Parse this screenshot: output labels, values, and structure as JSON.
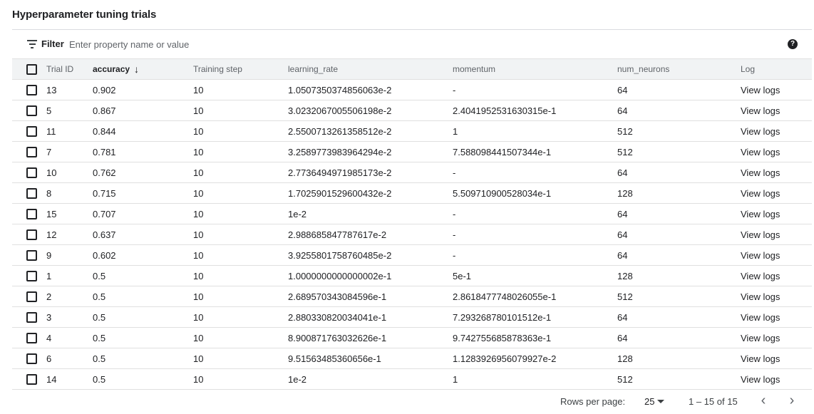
{
  "title": "Hyperparameter tuning trials",
  "filter": {
    "label": "Filter",
    "placeholder": "Enter property name or value",
    "help_icon": "?"
  },
  "columns": {
    "trial_id": "Trial ID",
    "accuracy": "accuracy",
    "sort_arrow": "↓",
    "training_step": "Training step",
    "learning_rate": "learning_rate",
    "momentum": "momentum",
    "num_neurons": "num_neurons",
    "log": "Log"
  },
  "rows": [
    {
      "trial_id": "13",
      "accuracy": "0.902",
      "training_step": "10",
      "learning_rate": "1.0507350374856063e-2",
      "momentum": "-",
      "num_neurons": "64",
      "log": "View logs"
    },
    {
      "trial_id": "5",
      "accuracy": "0.867",
      "training_step": "10",
      "learning_rate": "3.0232067005506198e-2",
      "momentum": "2.4041952531630315e-1",
      "num_neurons": "64",
      "log": "View logs"
    },
    {
      "trial_id": "11",
      "accuracy": "0.844",
      "training_step": "10",
      "learning_rate": "2.5500713261358512e-2",
      "momentum": "1",
      "num_neurons": "512",
      "log": "View logs"
    },
    {
      "trial_id": "7",
      "accuracy": "0.781",
      "training_step": "10",
      "learning_rate": "3.2589773983964294e-2",
      "momentum": "7.588098441507344e-1",
      "num_neurons": "512",
      "log": "View logs"
    },
    {
      "trial_id": "10",
      "accuracy": "0.762",
      "training_step": "10",
      "learning_rate": "2.7736494971985173e-2",
      "momentum": "-",
      "num_neurons": "64",
      "log": "View logs"
    },
    {
      "trial_id": "8",
      "accuracy": "0.715",
      "training_step": "10",
      "learning_rate": "1.7025901529600432e-2",
      "momentum": "5.509710900528034e-1",
      "num_neurons": "128",
      "log": "View logs"
    },
    {
      "trial_id": "15",
      "accuracy": "0.707",
      "training_step": "10",
      "learning_rate": "1e-2",
      "momentum": "-",
      "num_neurons": "64",
      "log": "View logs"
    },
    {
      "trial_id": "12",
      "accuracy": "0.637",
      "training_step": "10",
      "learning_rate": "2.988685847787617e-2",
      "momentum": "-",
      "num_neurons": "64",
      "log": "View logs"
    },
    {
      "trial_id": "9",
      "accuracy": "0.602",
      "training_step": "10",
      "learning_rate": "3.9255801758760485e-2",
      "momentum": "-",
      "num_neurons": "64",
      "log": "View logs"
    },
    {
      "trial_id": "1",
      "accuracy": "0.5",
      "training_step": "10",
      "learning_rate": "1.0000000000000002e-1",
      "momentum": "5e-1",
      "num_neurons": "128",
      "log": "View logs"
    },
    {
      "trial_id": "2",
      "accuracy": "0.5",
      "training_step": "10",
      "learning_rate": "2.689570343084596e-1",
      "momentum": "2.8618477748026055e-1",
      "num_neurons": "512",
      "log": "View logs"
    },
    {
      "trial_id": "3",
      "accuracy": "0.5",
      "training_step": "10",
      "learning_rate": "2.880330820034041e-1",
      "momentum": "7.293268780101512e-1",
      "num_neurons": "64",
      "log": "View logs"
    },
    {
      "trial_id": "4",
      "accuracy": "0.5",
      "training_step": "10",
      "learning_rate": "8.900871763032626e-1",
      "momentum": "9.742755685878363e-1",
      "num_neurons": "64",
      "log": "View logs"
    },
    {
      "trial_id": "6",
      "accuracy": "0.5",
      "training_step": "10",
      "learning_rate": "9.51563485360656e-1",
      "momentum": "1.1283926956079927e-2",
      "num_neurons": "128",
      "log": "View logs"
    },
    {
      "trial_id": "14",
      "accuracy": "0.5",
      "training_step": "10",
      "learning_rate": "1e-2",
      "momentum": "1",
      "num_neurons": "512",
      "log": "View logs"
    }
  ],
  "footer": {
    "rows_per_page_label": "Rows per page:",
    "rows_per_page_value": "25",
    "range": "1 – 15 of 15",
    "prev_icon": "‹",
    "next_icon": "›"
  }
}
